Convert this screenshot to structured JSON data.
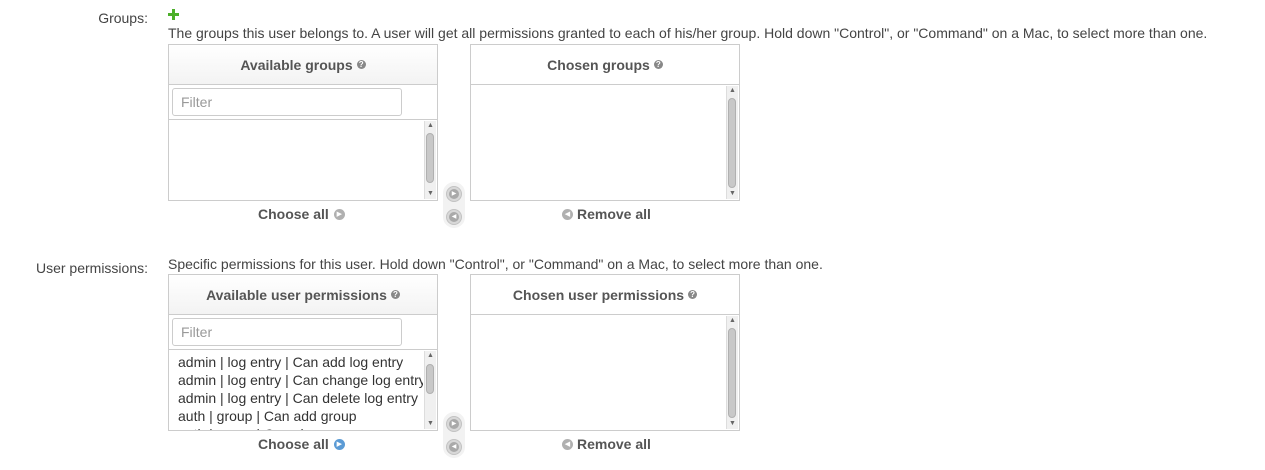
{
  "groups": {
    "label": "Groups:",
    "add_icon": "plus-icon",
    "help_text": "The groups this user belongs to. A user will get all permissions granted to each of his/her group. Hold down \"Control\", or \"Command\" on a Mac, to select more than one.",
    "available_title": "Available groups",
    "chosen_title": "Chosen groups",
    "filter_placeholder": "Filter",
    "available_items": [],
    "chosen_items": [],
    "choose_all_label": "Choose all",
    "remove_all_label": "Remove all"
  },
  "permissions": {
    "label": "User permissions:",
    "help_text": "Specific permissions for this user. Hold down \"Control\", or \"Command\" on a Mac, to select more than one.",
    "available_title": "Available user permissions",
    "chosen_title": "Chosen user permissions",
    "filter_placeholder": "Filter",
    "available_items": [
      "admin | log entry | Can add log entry",
      "admin | log entry | Can change log entry",
      "admin | log entry | Can delete log entry",
      "auth | group | Can add group",
      "auth | group | Can change group"
    ],
    "chosen_items": [],
    "choose_all_label": "Choose all",
    "remove_all_label": "Remove all"
  },
  "colors": {
    "border": "#cccccc",
    "text": "#444444",
    "accent_blue": "#5b9bd5",
    "add_green": "#4caf2a"
  }
}
